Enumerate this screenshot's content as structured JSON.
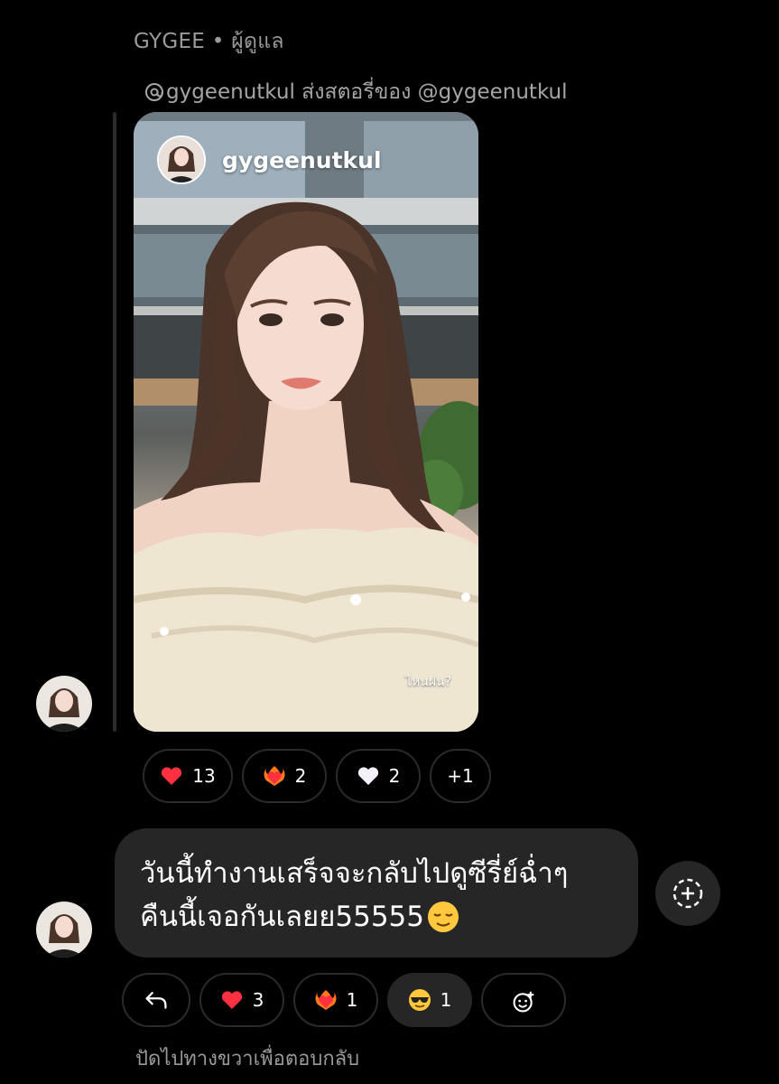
{
  "header": {
    "sender_line": "GYGEE • ผู้ดูแล",
    "share_line": "gygeenutkul ส่งสตอรี่ของ @gygeenutkul"
  },
  "story": {
    "username": "gygeenutkul",
    "caption": "ไหนฝน?"
  },
  "story_reactions": [
    {
      "icon": "heart-red-icon",
      "count": "13"
    },
    {
      "icon": "heart-on-fire-icon",
      "count": "2"
    },
    {
      "icon": "heart-white-icon",
      "count": "2"
    },
    {
      "icon": "more-reactions",
      "count": "+1"
    }
  ],
  "message": {
    "line1": "วันนี้ทำงานเสร็จจะกลับไปดูซีรี่ย์ฉ่ำๆ",
    "line2": "คืนนี้เจอกันเลยย55555"
  },
  "message_reactions": [
    {
      "icon": "reply-icon",
      "count": ""
    },
    {
      "icon": "heart-red-icon",
      "count": "3"
    },
    {
      "icon": "heart-on-fire-icon",
      "count": "1"
    },
    {
      "icon": "sunglasses-face-icon",
      "count": "1"
    },
    {
      "icon": "add-reaction-icon",
      "count": ""
    }
  ],
  "hint": "ปัดไปทางขวาเพื่อตอบกลับ",
  "colors": {
    "background": "#000000",
    "bubble": "#262626",
    "muted_text": "#9a9a9a",
    "heart": "#ff3040"
  }
}
